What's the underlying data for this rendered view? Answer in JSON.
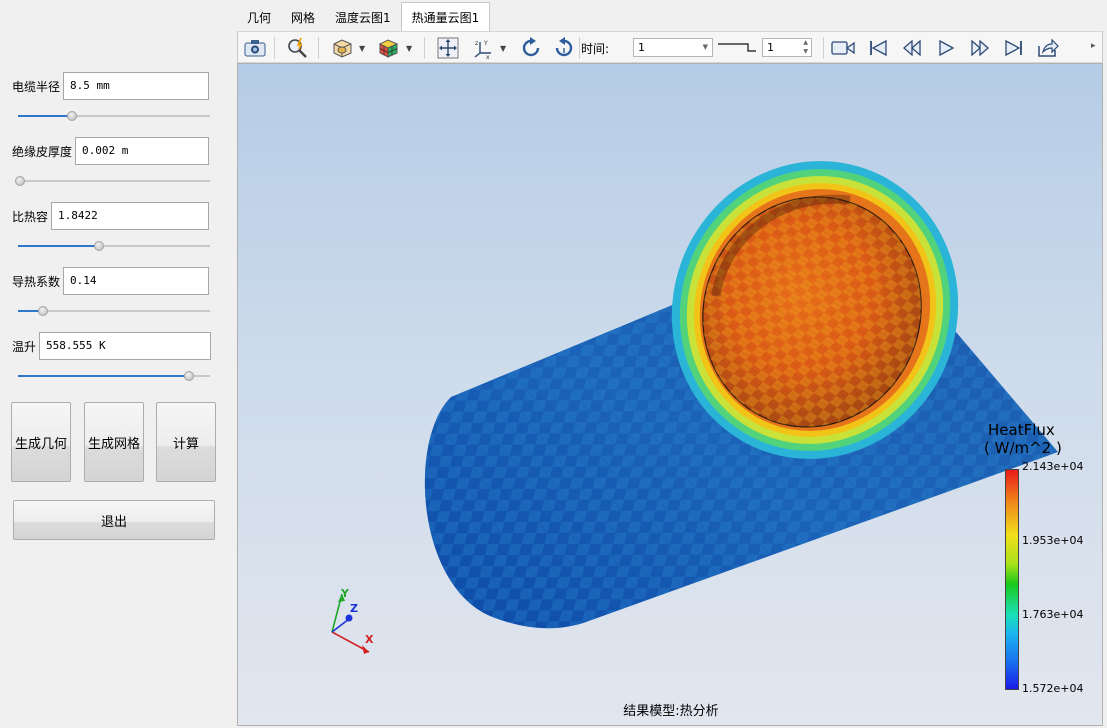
{
  "left_panel": {
    "params": [
      {
        "label": "电缆半径",
        "value": "8.5 mm",
        "slider": 0.28
      },
      {
        "label": "绝缘皮厚度",
        "value": "0.002 m",
        "slider": 0.0
      },
      {
        "label": "比热容",
        "value": "1.8422",
        "slider": 0.42
      },
      {
        "label": "导热系数",
        "value": "0.14",
        "slider": 0.13
      },
      {
        "label": "温升",
        "value": "558.555 K",
        "slider": 0.89
      }
    ],
    "buttons": {
      "geometry": "生成几何",
      "mesh": "生成网格",
      "compute": "计算",
      "exit": "退出"
    }
  },
  "tabs": [
    {
      "label": "几何",
      "active": false
    },
    {
      "label": "网格",
      "active": false
    },
    {
      "label": "温度云图1",
      "active": false
    },
    {
      "label": "热通量云图1",
      "active": true
    }
  ],
  "toolbar": {
    "icons": [
      "camera-icon",
      "zoom-fit-icon",
      "display-mode-icon",
      "color-cube-icon",
      "pan-icon",
      "axes-icon",
      "rotate-cw-icon",
      "rotate-ccw-icon"
    ],
    "time_label": "时间:",
    "time_select_value": "1",
    "step_value": "1",
    "playback_icons": [
      "record-video-icon",
      "first-frame-icon",
      "prev-frame-icon",
      "play-icon",
      "next-frame-icon",
      "last-frame-icon",
      "export-icon"
    ]
  },
  "viewport": {
    "caption": "结果模型:热分析",
    "legend": {
      "title": "HeatFlux",
      "unit": "( W/m^2 )",
      "ticks": [
        "2.143e+04",
        "1.953e+04",
        "1.763e+04",
        "1.572e+04"
      ]
    },
    "axes": {
      "x": "X",
      "y": "Y",
      "z": "Z"
    }
  },
  "colors": {
    "accent": "#2f77c9",
    "legend_top": "#e8221a",
    "legend_bottom": "#1a1ae8"
  }
}
